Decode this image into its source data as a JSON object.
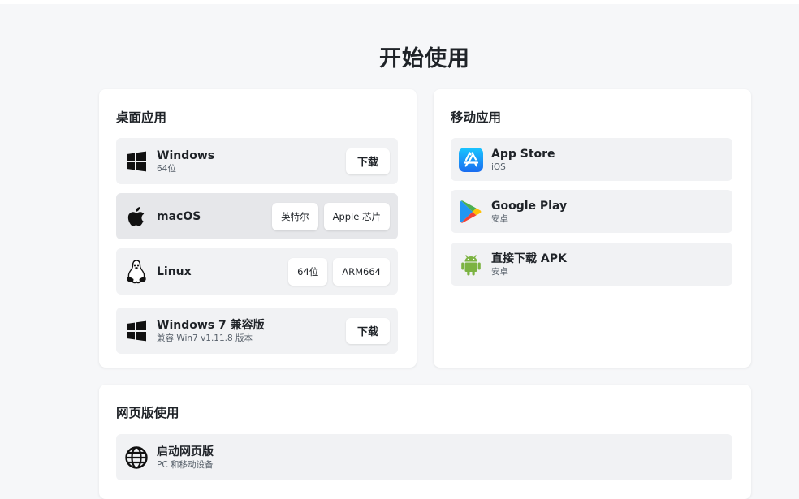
{
  "page": {
    "title": "开始使用"
  },
  "desktop": {
    "title": "桌面应用",
    "items": [
      {
        "name": "Windows",
        "sub": "64位",
        "icon": "windows-icon",
        "buttons": [
          "下载"
        ]
      },
      {
        "name": "macOS",
        "sub": "",
        "icon": "apple-icon",
        "buttons": [
          "英特尔",
          "Apple 芯片"
        ]
      },
      {
        "name": "Linux",
        "sub": "",
        "icon": "linux-icon",
        "buttons": [
          "64位",
          "ARM664"
        ]
      },
      {
        "name": "Windows 7 兼容版",
        "sub": "兼容 Win7 v1.11.8 版本",
        "icon": "windows-icon",
        "buttons": [
          "下载"
        ]
      }
    ]
  },
  "mobile": {
    "title": "移动应用",
    "items": [
      {
        "name": "App Store",
        "sub": "iOS",
        "icon": "app-store-icon"
      },
      {
        "name": "Google Play",
        "sub": "安卓",
        "icon": "google-play-icon"
      },
      {
        "name": "直接下载 APK",
        "sub": "安卓",
        "icon": "android-icon"
      }
    ]
  },
  "web": {
    "title": "网页版使用",
    "items": [
      {
        "name": "启动网页版",
        "sub": "PC 和移动设备",
        "icon": "globe-icon"
      }
    ]
  },
  "colors": {
    "page_bg": "#f6f7f9",
    "card_bg": "#ffffff",
    "row_bg": "#f1f2f4",
    "row_active_bg": "#e6e7ea",
    "app_store_blue": "#1a8cff",
    "android_green": "#7cb342"
  }
}
